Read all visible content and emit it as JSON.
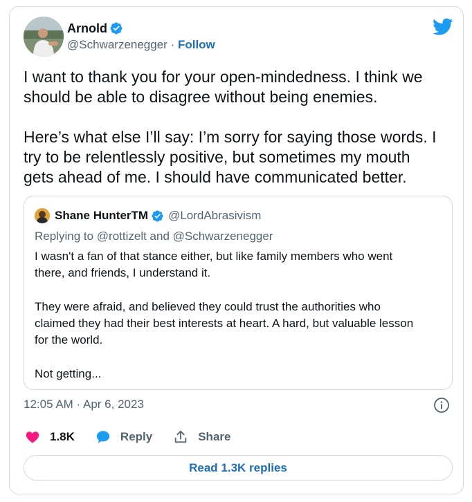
{
  "author": {
    "name": "Arnold",
    "handle": "@Schwarzenegger",
    "separator": " · ",
    "follow_label": "Follow"
  },
  "tweet": {
    "text": "I want to thank you for your open-mindedness. I think we\nshould be able to disagree without being enemies.\n\nHere’s what else I’ll say: I’m sorry for saying those words. I\ntry to be relentlessly positive, but sometimes my mouth\ngets ahead of me. I should have communicated better."
  },
  "quote": {
    "name": "Shane HunterTM",
    "handle": "@LordAbrasivism",
    "replying_to": "Replying to @rottizelt and @Schwarzenegger",
    "text": "I wasn't a fan of that stance either, but like family members who went\nthere, and friends, I understand it.\n\nThey were afraid, and believed they could trust the authorities who\nclaimed they had their best interests at heart. A hard, but valuable lesson\nfor the world.\n\nNot getting..."
  },
  "meta": {
    "timestamp": "12:05 AM · Apr 6, 2023"
  },
  "actions": {
    "like_count": "1.8K",
    "reply_label": "Reply",
    "share_label": "Share"
  },
  "read_replies_label": "Read 1.3K replies",
  "icons": {
    "verified": "verified-badge-icon",
    "logo": "twitter-bird-icon",
    "info": "info-icon",
    "like": "heart-icon",
    "reply": "speech-bubble-icon",
    "share": "share-arrow-icon"
  },
  "colors": {
    "accent": "#1d9bf0",
    "link": "#1d6fb8",
    "like": "#f91880",
    "muted": "#536471",
    "border": "#cfd9de"
  }
}
